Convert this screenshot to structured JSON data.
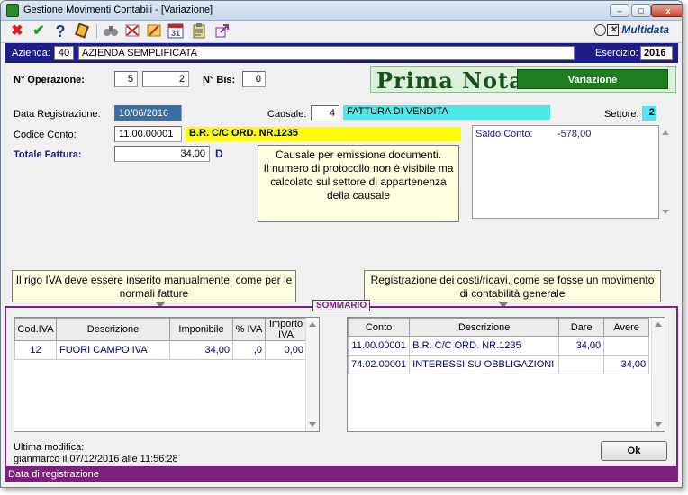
{
  "window": {
    "title": "Gestione Movimenti Contabili - [Variazione]",
    "controls": {
      "minimize": "–",
      "maximize": "□",
      "close": "x"
    }
  },
  "toolbar": {
    "icons": [
      "close-x-icon",
      "confirm-check-icon",
      "help-icon",
      "notebook-icon",
      "binoculars-icon",
      "delete-icon",
      "edit-icon",
      "calendar-icon",
      "clipboard-icon",
      "export-icon"
    ],
    "calendar_number": "31",
    "brand": "Multidata"
  },
  "header": {
    "azienda_label": "Azienda:",
    "azienda_code": "40",
    "azienda_name": "AZIENDA SEMPLIFICATA",
    "esercizio_label": "Esercizio:",
    "esercizio_value": "2016"
  },
  "operation": {
    "n_operazione_label": "N° Operazione:",
    "n_operazione_a": "5",
    "n_operazione_b": "2",
    "n_bis_label": "N° Bis:",
    "n_bis_value": "0"
  },
  "banner": {
    "title": "Prima Nota",
    "mode": "Variazione"
  },
  "form": {
    "data_registrazione_label": "Data Registrazione:",
    "data_registrazione_value": "10/06/2016",
    "causale_label": "Causale:",
    "causale_code": "4",
    "causale_desc": "FATTURA DI VENDITA",
    "settore_label": "Settore:",
    "settore_value": "2",
    "codice_conto_label": "Codice Conto:",
    "codice_conto_value": "11.00.00001",
    "codice_conto_desc": "B.R. C/C ORD. NR.1235",
    "totale_fattura_label": "Totale Fattura:",
    "totale_fattura_value": "34,00",
    "totale_fattura_suffix": "D",
    "saldo_conto_label": "Saldo Conto:",
    "saldo_conto_value": "-578,00"
  },
  "notes": {
    "causale_note": "Causale per emissione documenti.\nIl numero di protocollo non è visibile ma calcolato sul settore di appartenenza della causale",
    "iva_note": "Il rigo IVA deve essere inserito manualmente, come per le normali fatture",
    "costi_note": "Registrazione dei costi/ricavi, come se fosse un movimento di contabilità generale"
  },
  "sommario": {
    "label": "SOMMARIO",
    "iva_table": {
      "headers": [
        "Cod.IVA",
        "Descrizione",
        "Imponibile",
        "% IVA",
        "Importo IVA"
      ],
      "rows": [
        [
          "12",
          "FUORI CAMPO IVA",
          "34,00",
          ",0",
          "0,00"
        ]
      ]
    },
    "conti_table": {
      "headers": [
        "Conto",
        "Descrizione",
        "Dare",
        "Avere"
      ],
      "rows": [
        [
          "11.00.00001",
          "B.R. C/C ORD. NR.1235",
          "34,00",
          ""
        ],
        [
          "74.02.00001",
          "INTERESSI SU OBBLIGAZIONI",
          "",
          "34,00"
        ]
      ]
    }
  },
  "footer": {
    "ultima_modifica_label": "Ultima modifica:",
    "ultima_modifica_value": "gianmarco il 07/12/2016 alle 11:56:28",
    "ok_label": "Ok",
    "status": "Data di registrazione"
  }
}
